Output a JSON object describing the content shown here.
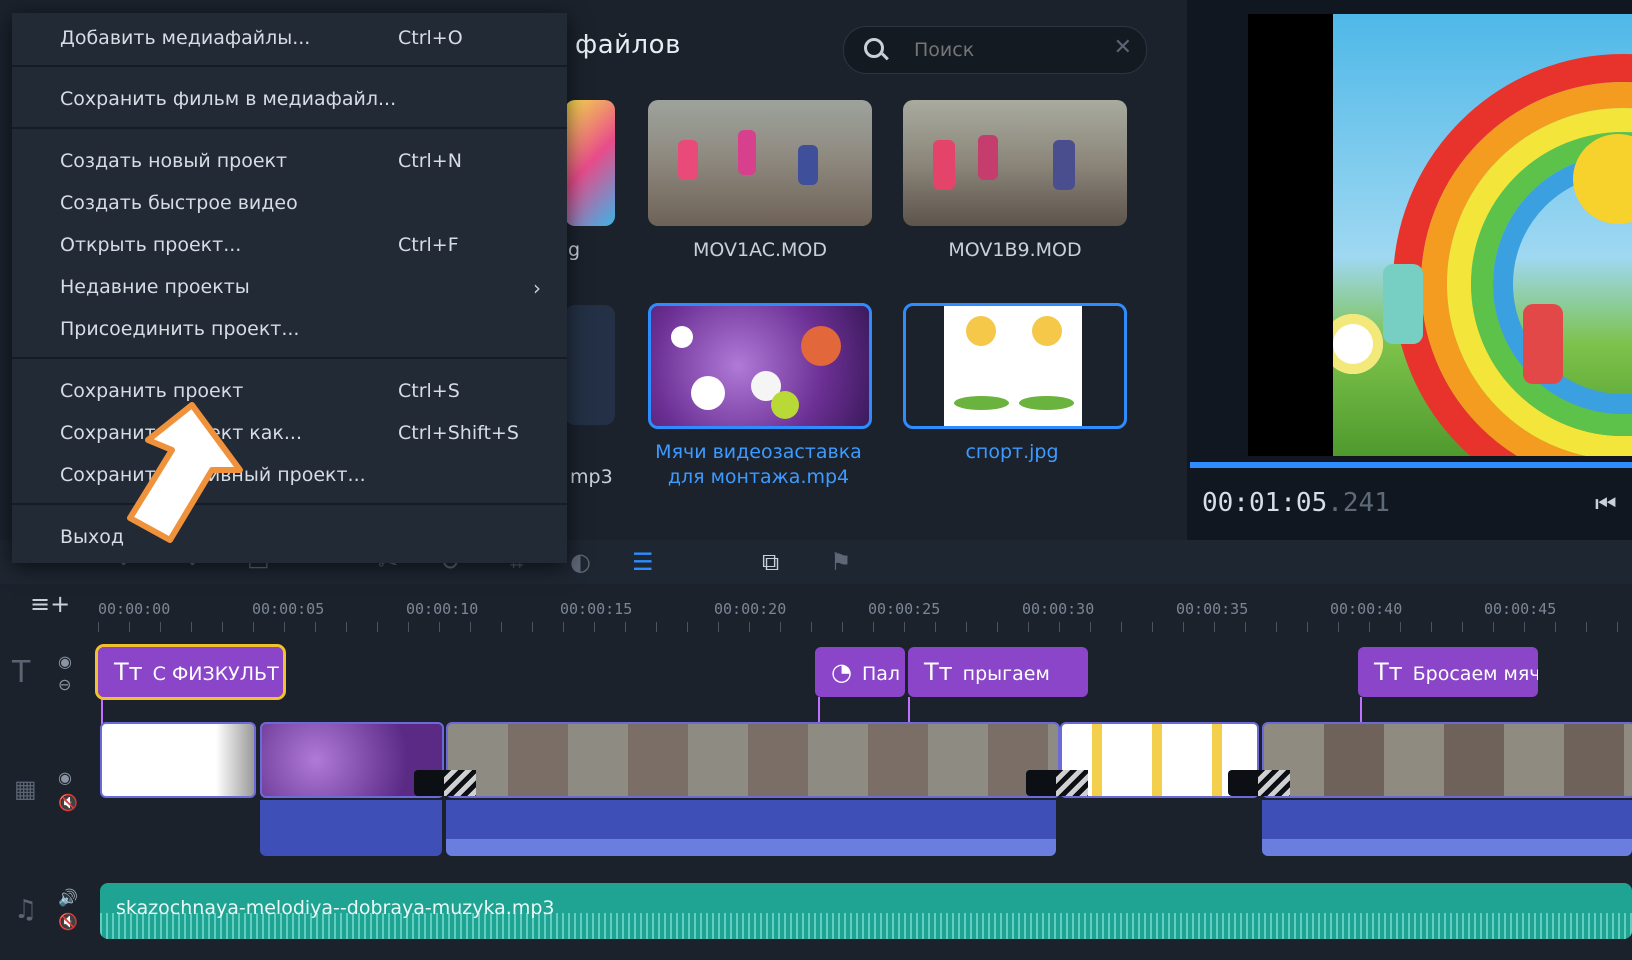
{
  "media": {
    "title": "файлов",
    "search_placeholder": "Поиск",
    "items": [
      {
        "name": "g"
      },
      {
        "name": "MOV1AC.MOD"
      },
      {
        "name": "MOV1B9.MOD"
      },
      {
        "name": "mp3"
      },
      {
        "name": "Мячи видеозаставка\nдля монтажа.mp4"
      },
      {
        "name": "спорт.jpg"
      }
    ]
  },
  "preview": {
    "time_main": "00:01:05",
    "time_ms": ".241"
  },
  "file_menu": {
    "items": [
      {
        "label": "Добавить медиафайлы...",
        "shortcut": "Ctrl+O"
      },
      {
        "label": "Сохранить фильм в медиафайл...",
        "shortcut": ""
      },
      {
        "label": "Создать новый проект",
        "shortcut": "Ctrl+N"
      },
      {
        "label": "Создать быстрое видео",
        "shortcut": ""
      },
      {
        "label": "Открыть проект...",
        "shortcut": "Ctrl+F"
      },
      {
        "label": "Недавние проекты",
        "shortcut": ""
      },
      {
        "label": "Присоединить проект...",
        "shortcut": ""
      },
      {
        "label": "Сохранить проект",
        "shortcut": "Ctrl+S"
      },
      {
        "label": "Сохранить проект как...",
        "shortcut": "Ctrl+Shift+S"
      },
      {
        "label": "Сохранить архивный проект...",
        "shortcut": ""
      },
      {
        "label": "Выход",
        "shortcut": ""
      }
    ]
  },
  "timeline": {
    "ticks": [
      "00:00:00",
      "00:00:05",
      "00:00:10",
      "00:00:15",
      "00:00:20",
      "00:00:25",
      "00:00:30",
      "00:00:35",
      "00:00:40",
      "00:00:45"
    ],
    "titles": [
      "С ФИЗКУЛЬТ",
      "Пал",
      "прыгаем",
      "Бросаем мяч"
    ],
    "music_file": "skazochnaya-melodiya--dobraya-muzyka.mp3"
  },
  "colors": {
    "accent": "#2f8cff",
    "title_clip": "#8a45c9",
    "music": "#1fa393",
    "annotation": "#f0913c"
  }
}
